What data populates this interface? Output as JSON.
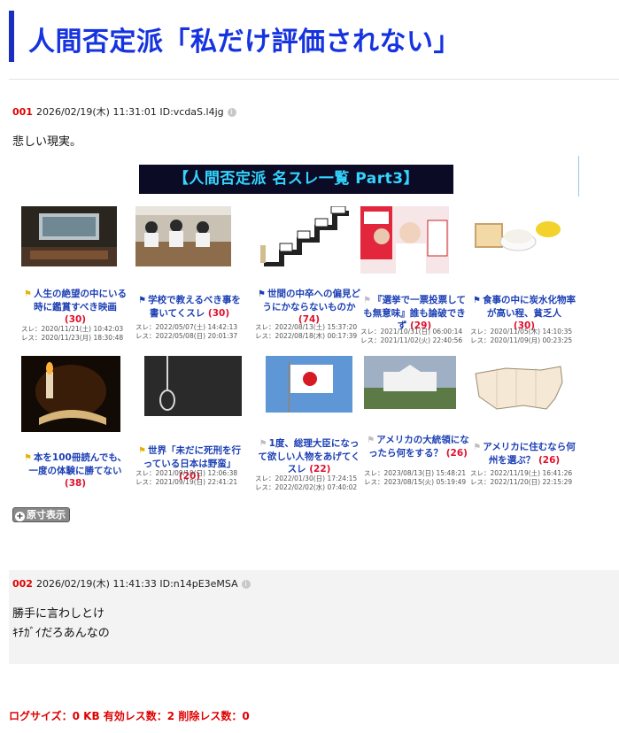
{
  "page": {
    "title": "人間否定派「私だけ評価されない」"
  },
  "posts": [
    {
      "num": "001",
      "datetime": "2026/02/19(木) 11:31:01 ID:vcdaS.l4jg",
      "lines": [
        "悲しい現実。"
      ]
    },
    {
      "num": "002",
      "datetime": "2026/02/19(木) 11:41:33 ID:n14pE3eMSA",
      "lines": [
        "勝手に言わしとけ",
        "ｷﾁｶﾞｲだろあんなの"
      ]
    }
  ],
  "image": {
    "banner": "【人間否定派 名スレ一覧 Part3】",
    "cards": [
      {
        "title": "人生の絶望の中にいる時に鑑賞すべき映画",
        "count": "(30)",
        "thread": "スレ：2020/11/21(土) 10:42:03",
        "res": "レス：2020/11/23(月) 18:30:48"
      },
      {
        "title": "学校で教えるべき事を書いてくスレ",
        "count": "(30)",
        "thread": "スレ：2022/05/07(土) 14:42:13",
        "res": "レス：2022/05/08(日) 20:01:37"
      },
      {
        "title": "世間の中卒への偏見どうにかならないものか",
        "count": "(74)",
        "thread": "スレ：2022/08/13(土) 15:37:20",
        "res": "レス：2022/08/18(木) 00:17:39"
      },
      {
        "title": "『選挙で一票投票しても無意味』誰も論破できず",
        "count": "(29)",
        "thread": "スレ：2021/10/31(日) 06:00:14",
        "res": "レス：2021/11/02(火) 22:40:56"
      },
      {
        "title": "食事の中に炭水化物率が高い程、貧乏人",
        "count": "(30)",
        "thread": "スレ：2020/11/05(木) 14:10:35",
        "res": "レス：2020/11/09(月) 00:23:25"
      },
      {
        "title": "本を100冊読んでも、一度の体験に勝てない",
        "count": "(38)",
        "thread": "",
        "res": ""
      },
      {
        "title": "世界「未だに死刑を行っている日本は野蛮」",
        "count": "(20)",
        "thread": "スレ：2021/09/19(日) 12:06:38",
        "res": "レス：2021/09/19(日) 22:41:21"
      },
      {
        "title": "1度、総理大臣になって欲しい人物をあげてくスレ",
        "count": "(22)",
        "thread": "スレ：2022/01/30(日) 17:24:15",
        "res": "レス：2022/02/02(水) 07:40:02"
      },
      {
        "title": "アメリカの大統領になったら何をする？",
        "count": "(26)",
        "thread": "スレ：2023/08/13(日) 15:48:21",
        "res": "レス：2023/08/15(火) 05:19:49"
      },
      {
        "title": "アメリカに住むなら何州を選ぶ？",
        "count": "(26)",
        "thread": "スレ：2022/11/19(土) 16:41:26",
        "res": "レス：2022/11/20(日) 22:15:29"
      }
    ]
  },
  "orig_button": "原寸表示",
  "footer": "ログサイズ：0 KB 有効レス数：2 削除レス数：0",
  "colors": {
    "accent": "#1633e0",
    "post_num": "#e00000",
    "count": "#e0102d"
  }
}
